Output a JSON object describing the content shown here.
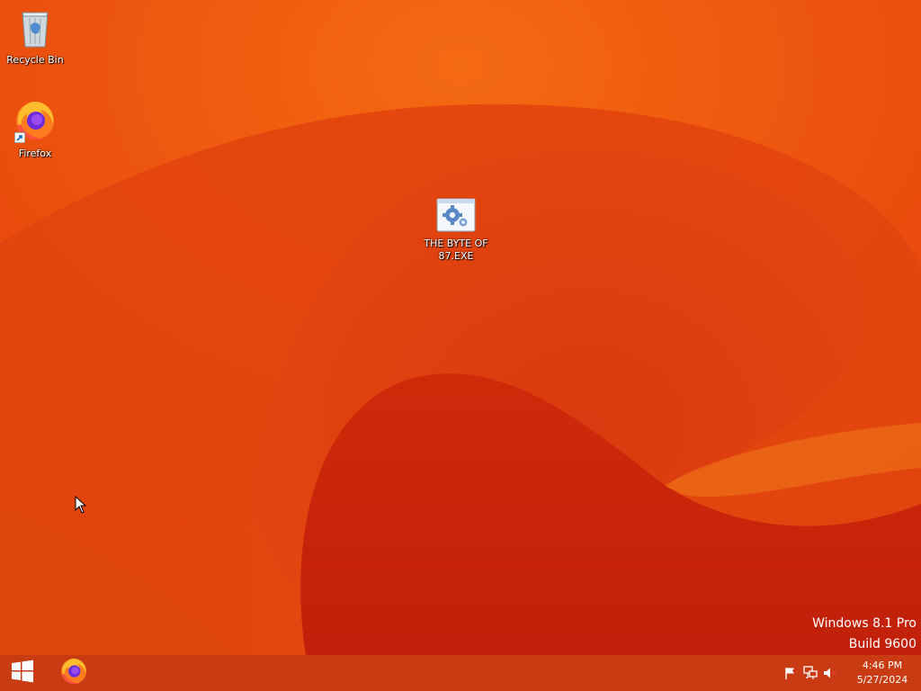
{
  "desktop": {
    "icons": [
      {
        "label": "Recycle Bin",
        "icon": "recycle-bin-icon"
      },
      {
        "label": "Firefox",
        "icon": "firefox-icon"
      },
      {
        "label": "THE BYTE OF 87.EXE",
        "icon": "executable-gear-icon"
      }
    ],
    "watermark": {
      "line1": "Windows 8.1 Pro",
      "line2": "Build 9600"
    }
  },
  "taskbar": {
    "start_icon": "windows-logo-icon",
    "pinned": [
      {
        "name": "Firefox",
        "icon": "firefox-icon"
      }
    ],
    "tray": {
      "icons": [
        "action-center-flag-icon",
        "network-icon",
        "volume-muted-icon"
      ],
      "time": "4:46 PM",
      "date": "5/27/2024"
    }
  },
  "colors": {
    "wallpaper_base": "#e84a0c",
    "wallpaper_dark": "#c52a0c",
    "taskbar": "#c93c13",
    "text": "#ffffff"
  }
}
